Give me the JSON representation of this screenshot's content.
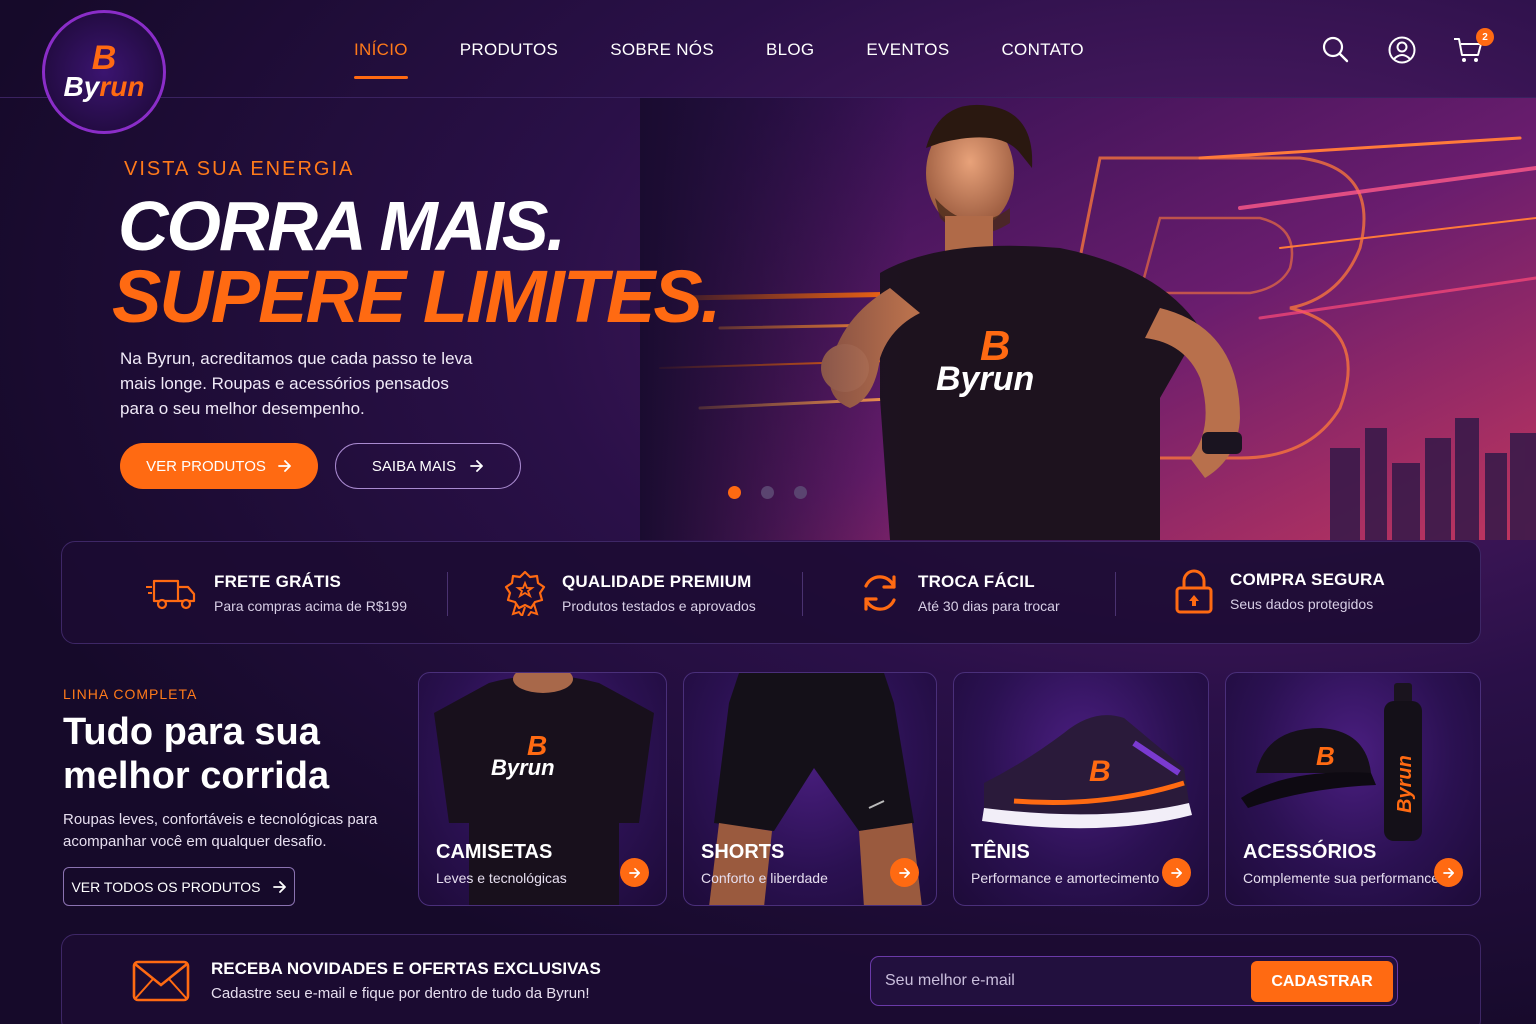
{
  "brand": {
    "logo_mark": "B",
    "logo_by": "By",
    "logo_run": "run",
    "accent": "#ff6a12",
    "bg": "#1a0c30"
  },
  "nav": {
    "items": [
      "INÍCIO",
      "PRODUTOS",
      "SOBRE NÓS",
      "BLOG",
      "EVENTOS",
      "CONTATO"
    ],
    "active": "INÍCIO"
  },
  "header_icons": {
    "search": "search-icon",
    "account": "user-icon",
    "cart": "cart-icon",
    "cart_count": "2"
  },
  "hero": {
    "tagline": "VISTA SUA ENERGIA",
    "title_line1": "CORRA MAIS.",
    "title_line2": "SUPERE LIMITES.",
    "paragraph": "Na Byrun, acreditamos que cada passo te leva mais longe. Roupas e acessórios pensados para o seu melhor desempenho.",
    "primary_button": "VER PRODUTOS",
    "secondary_button": "SAIBA MAIS",
    "shirt_brand_mark": "B",
    "shirt_brand": "Byrun",
    "slides": 3,
    "active_slide": 1
  },
  "features": [
    {
      "title": "FRETE GRÁTIS",
      "subtitle": "Para compras acima de R$199",
      "icon": "truck-icon"
    },
    {
      "title": "QUALIDADE PREMIUM",
      "subtitle": "Produtos testados e aprovados",
      "icon": "award-icon"
    },
    {
      "title": "TROCA FÁCIL",
      "subtitle": "Até 30 dias para trocar",
      "icon": "refresh-icon"
    },
    {
      "title": "COMPRA SEGURA",
      "subtitle": "Seus dados protegidos",
      "icon": "lock-icon"
    }
  ],
  "categories_section": {
    "tag": "LINHA COMPLETA",
    "heading": "Tudo para sua melhor corrida",
    "text": "Roupas leves, confortáveis e tecnológicas para acompanhar você em qualquer desafio.",
    "button": "VER TODOS OS PRODUTOS"
  },
  "categories": [
    {
      "title": "CAMISETAS",
      "subtitle": "Leves e tecnológicas",
      "image": "tshirt"
    },
    {
      "title": "SHORTS",
      "subtitle": "Conforto e liberdade",
      "image": "shorts"
    },
    {
      "title": "TÊNIS",
      "subtitle": "Performance e amortecimento",
      "image": "sneaker"
    },
    {
      "title": "ACESSÓRIOS",
      "subtitle": "Complemente sua performance",
      "image": "cap-bottle"
    }
  ],
  "newsletter": {
    "title": "RECEBA NOVIDADES E OFERTAS EXCLUSIVAS",
    "subtitle": "Cadastre seu e-mail e fique por dentro de tudo da Byrun!",
    "placeholder": "Seu melhor e-mail",
    "button": "CADASTRAR",
    "icon": "mail-icon"
  }
}
